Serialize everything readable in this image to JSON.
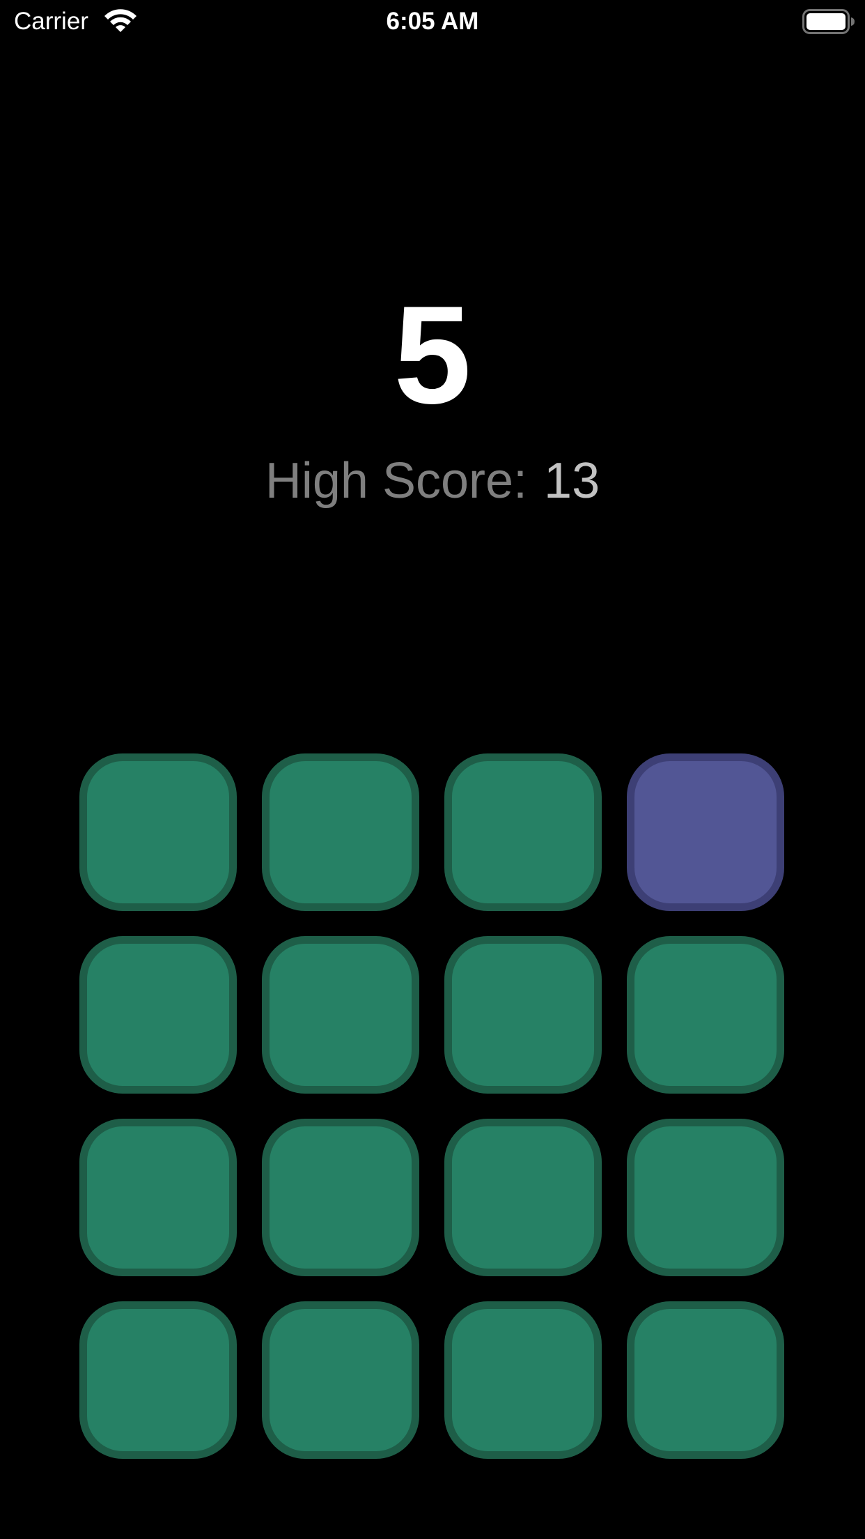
{
  "status_bar": {
    "carrier": "Carrier",
    "time": "6:05 AM",
    "wifi_icon": "wifi-icon",
    "battery_icon": "battery-full-icon"
  },
  "game": {
    "score": "5",
    "high_score_label": "High Score:",
    "high_score_value": "13"
  },
  "grid": {
    "rows": 4,
    "columns": 4,
    "tile_color": "#268165",
    "tile_border_color": "#1e5e48",
    "highlight_color": "#525695",
    "highlight_border_color": "#3d3f75",
    "highlighted_tile": {
      "row": 1,
      "column": 4
    }
  }
}
